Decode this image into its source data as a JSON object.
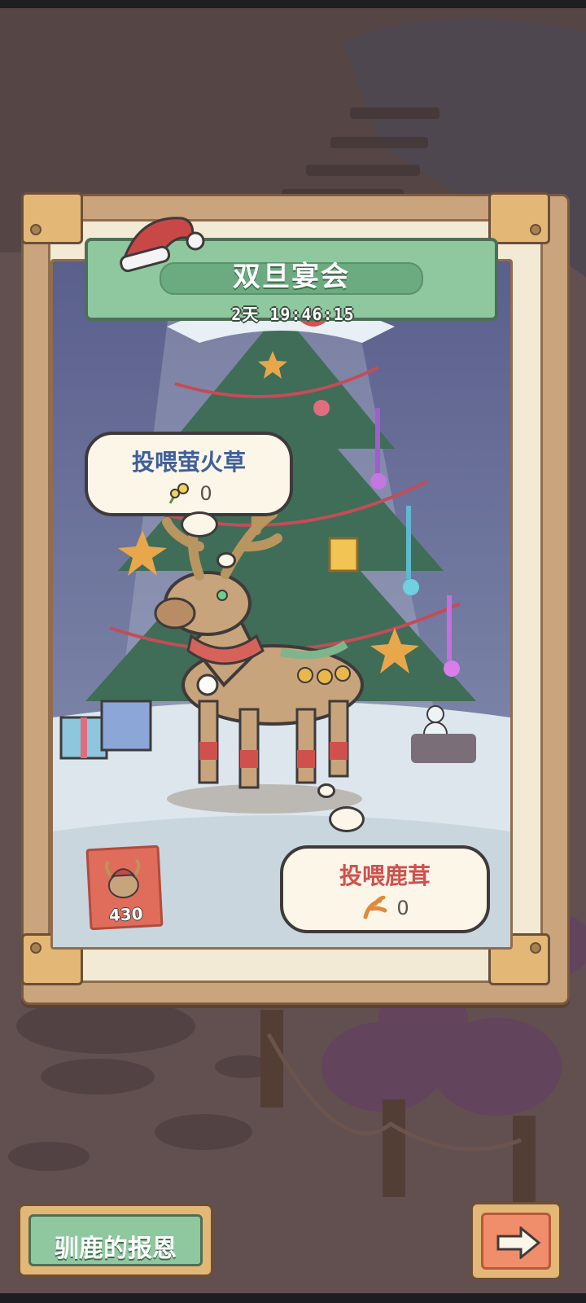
{
  "event": {
    "title": "双旦宴会",
    "countdown": "2天 19:46:15"
  },
  "feed_firefly_grass": {
    "label": "投喂萤火草",
    "count": "0",
    "icon": "firefly-grass-icon"
  },
  "feed_antler": {
    "label": "投喂鹿茸",
    "count": "0",
    "icon": "antler-icon"
  },
  "reindeer_badge": {
    "count": "430",
    "icon": "reindeer-portrait-icon"
  },
  "bottom": {
    "reward_button": "驯鹿的报恩",
    "next_icon": "arrow-right-icon"
  },
  "colors": {
    "banner_green": "#8fc89f",
    "frame_wood": "#c9a47c",
    "bubble_blue_text": "#3f5f9a",
    "bubble_red_text": "#d0504e",
    "next_button": "#f08d6b"
  }
}
